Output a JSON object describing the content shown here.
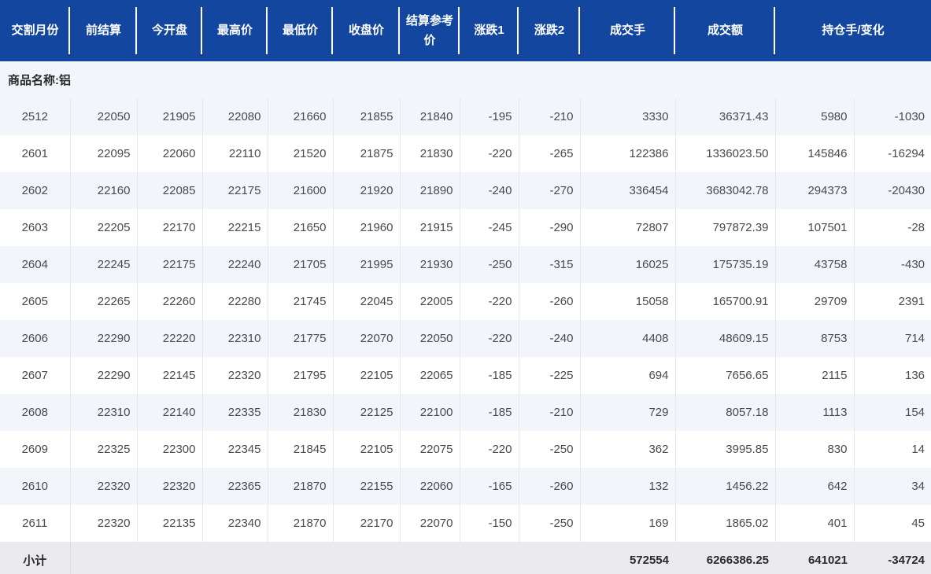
{
  "colors": {
    "header_blue": "#13469E",
    "orange": "#F9B078",
    "row_alt": "#F2F5FA",
    "subtotal_bg": "#EBEBEE",
    "grid": "#E8E8EC",
    "text_data": "#4A4A4E",
    "text_dark": "#2A2A2C"
  },
  "table": {
    "columns": [
      "交割月份",
      "前结算",
      "今开盘",
      "最高价",
      "最低价",
      "收盘价",
      "结算参考价",
      "涨跌1",
      "涨跌2",
      "成交手",
      "成交额",
      "持仓手/变化"
    ],
    "product_row": {
      "label": "商品名称:铝"
    },
    "rows": [
      [
        "2512",
        "22050",
        "21905",
        "22080",
        "21660",
        "21855",
        "21840",
        "-195",
        "-210",
        "3330",
        "36371.43",
        "5980",
        "-1030"
      ],
      [
        "2601",
        "22095",
        "22060",
        "22110",
        "21520",
        "21875",
        "21830",
        "-220",
        "-265",
        "122386",
        "1336023.50",
        "145846",
        "-16294"
      ],
      [
        "2602",
        "22160",
        "22085",
        "22175",
        "21600",
        "21920",
        "21890",
        "-240",
        "-270",
        "336454",
        "3683042.78",
        "294373",
        "-20430"
      ],
      [
        "2603",
        "22205",
        "22170",
        "22215",
        "21650",
        "21960",
        "21915",
        "-245",
        "-290",
        "72807",
        "797872.39",
        "107501",
        "-28"
      ],
      [
        "2604",
        "22245",
        "22175",
        "22240",
        "21705",
        "21995",
        "21930",
        "-250",
        "-315",
        "16025",
        "175735.19",
        "43758",
        "-430"
      ],
      [
        "2605",
        "22265",
        "22260",
        "22280",
        "21745",
        "22045",
        "22005",
        "-220",
        "-260",
        "15058",
        "165700.91",
        "29709",
        "2391"
      ],
      [
        "2606",
        "22290",
        "22220",
        "22310",
        "21775",
        "22070",
        "22050",
        "-220",
        "-240",
        "4408",
        "48609.15",
        "8753",
        "714"
      ],
      [
        "2607",
        "22290",
        "22145",
        "22320",
        "21795",
        "22105",
        "22065",
        "-185",
        "-225",
        "694",
        "7656.65",
        "2115",
        "136"
      ],
      [
        "2608",
        "22310",
        "22140",
        "22335",
        "21830",
        "22125",
        "22100",
        "-185",
        "-210",
        "729",
        "8057.18",
        "1113",
        "154"
      ],
      [
        "2609",
        "22325",
        "22300",
        "22345",
        "21845",
        "22105",
        "22075",
        "-220",
        "-250",
        "362",
        "3995.85",
        "830",
        "14"
      ],
      [
        "2610",
        "22320",
        "22320",
        "22365",
        "21870",
        "22155",
        "22060",
        "-165",
        "-260",
        "132",
        "1456.22",
        "642",
        "34"
      ],
      [
        "2611",
        "22320",
        "22135",
        "22340",
        "21870",
        "22170",
        "22070",
        "-150",
        "-250",
        "169",
        "1865.02",
        "401",
        "45"
      ]
    ],
    "subtotal": {
      "label": "小计",
      "volume": "572554",
      "turnover": "6266386.25",
      "open_interest": "641021",
      "oi_change": "-34724"
    }
  }
}
